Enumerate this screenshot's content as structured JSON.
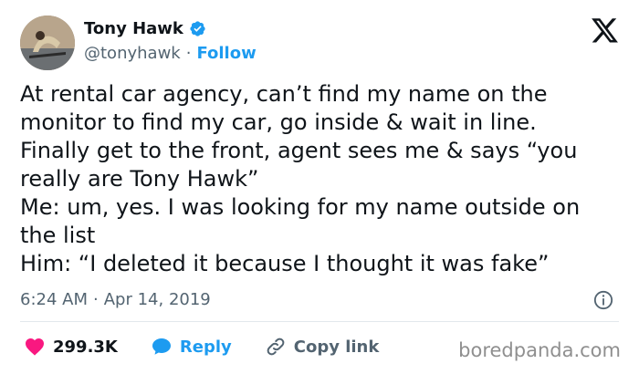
{
  "author": {
    "name": "Tony Hawk",
    "handle": "@tonyhawk",
    "follow_label": "Follow",
    "separator": "·"
  },
  "tweet": {
    "lines": [
      "At rental car agency, can’t find my name on the",
      "monitor to find my car, go inside & wait in line.",
      "Finally get to the front, agent sees me & says “you",
      "really are Tony Hawk”",
      "Me: um, yes. I was looking for my name outside on",
      "the list",
      "Him: “I deleted it because I thought it was fake”"
    ],
    "time": "6:24 AM",
    "date": "Apr 14, 2019",
    "separator": "·"
  },
  "actions": {
    "likes": "299.3K",
    "reply_label": "Reply",
    "copy_label": "Copy link"
  },
  "watermark": "boredpanda.com",
  "colors": {
    "accent": "#1d9bf0",
    "like": "#f91880",
    "muted": "#536471"
  },
  "icons": {
    "verified": "verified-badge-icon",
    "logo": "x-logo-icon",
    "info": "info-icon",
    "like": "heart-icon",
    "reply": "speech-bubble-icon",
    "copy": "link-icon"
  }
}
